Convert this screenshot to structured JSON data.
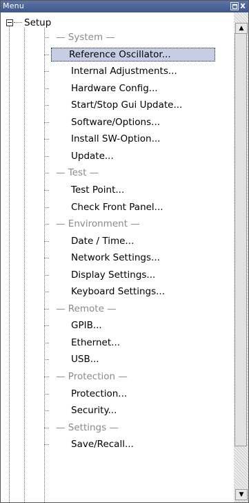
{
  "window": {
    "title": "Menu",
    "maximize_glyph": "",
    "close_glyph": "x"
  },
  "tree": {
    "root_label": "Setup",
    "items": [
      {
        "label": "— System —",
        "kind": "section"
      },
      {
        "label": "Reference Oscillator...",
        "kind": "item",
        "selected": true
      },
      {
        "label": "Internal Adjustments...",
        "kind": "item"
      },
      {
        "label": "Hardware Config...",
        "kind": "item"
      },
      {
        "label": "Start/Stop Gui Update...",
        "kind": "item"
      },
      {
        "label": "Software/Options...",
        "kind": "item"
      },
      {
        "label": "Install SW-Option...",
        "kind": "item"
      },
      {
        "label": "Update...",
        "kind": "item"
      },
      {
        "label": "— Test —",
        "kind": "section"
      },
      {
        "label": "Test Point...",
        "kind": "item"
      },
      {
        "label": "Check Front Panel...",
        "kind": "item"
      },
      {
        "label": "— Environment —",
        "kind": "section"
      },
      {
        "label": "Date / Time...",
        "kind": "item"
      },
      {
        "label": "Network Settings...",
        "kind": "item"
      },
      {
        "label": "Display Settings...",
        "kind": "item"
      },
      {
        "label": "Keyboard Settings...",
        "kind": "item"
      },
      {
        "label": "— Remote —",
        "kind": "section"
      },
      {
        "label": "GPIB...",
        "kind": "item"
      },
      {
        "label": "Ethernet...",
        "kind": "item"
      },
      {
        "label": "USB...",
        "kind": "item"
      },
      {
        "label": "— Protection —",
        "kind": "section"
      },
      {
        "label": "Protection...",
        "kind": "item"
      },
      {
        "label": "Security...",
        "kind": "item"
      },
      {
        "label": "— Settings —",
        "kind": "section"
      },
      {
        "label": "Save/Recall...",
        "kind": "item"
      }
    ]
  },
  "scrollbar": {
    "up_glyph": "▲",
    "down_glyph": "▼"
  },
  "colors": {
    "titlebar": "#4a62a0",
    "selection": "#c7cde4",
    "section_text": "#8a8a8a"
  }
}
